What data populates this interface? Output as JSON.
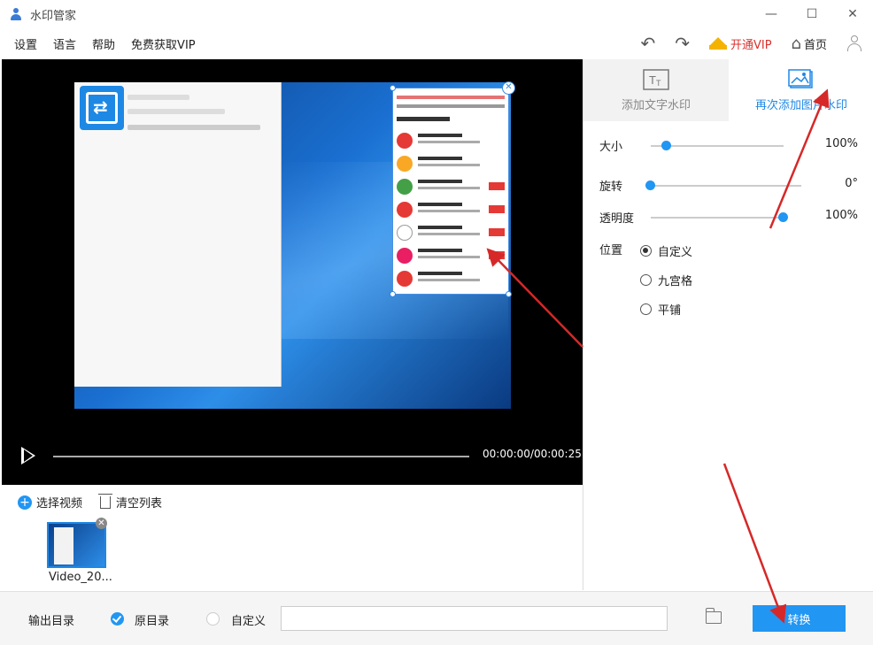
{
  "window": {
    "title": "水印管家",
    "minimize": "—",
    "maximize": "☐",
    "close": "✕"
  },
  "menu": {
    "items": [
      "设置",
      "语言",
      "帮助",
      "免费获取VIP"
    ]
  },
  "toolbar": {
    "undo": "↶",
    "redo": "↷",
    "vip_label": "开通VIP",
    "home_label": "首页",
    "home_glyph": "⌂"
  },
  "player": {
    "time": "00:00:00/00:00:25"
  },
  "tabs": [
    {
      "label": "添加文字水印",
      "active": false
    },
    {
      "label": "再次添加图片水印",
      "active": true
    }
  ],
  "settings": {
    "size": {
      "label": "大小",
      "value": "100%"
    },
    "rotate": {
      "label": "旋转",
      "value": "0°"
    },
    "opacity": {
      "label": "透明度",
      "value": "100%"
    },
    "position_label": "位置",
    "position_options": [
      {
        "label": "自定义",
        "checked": true
      },
      {
        "label": "九宫格",
        "checked": false
      },
      {
        "label": "平铺",
        "checked": false
      }
    ]
  },
  "list": {
    "select_video": "选择视频",
    "clear_list": "清空列表",
    "items": [
      {
        "name": "Video_20..."
      }
    ]
  },
  "output": {
    "label": "输出目录",
    "original_dir": "原目录",
    "custom": "自定义",
    "path": "",
    "convert_label": "转换"
  },
  "colors": {
    "accent": "#2196f3",
    "vip": "#d9302c",
    "arrow": "#d62828"
  }
}
